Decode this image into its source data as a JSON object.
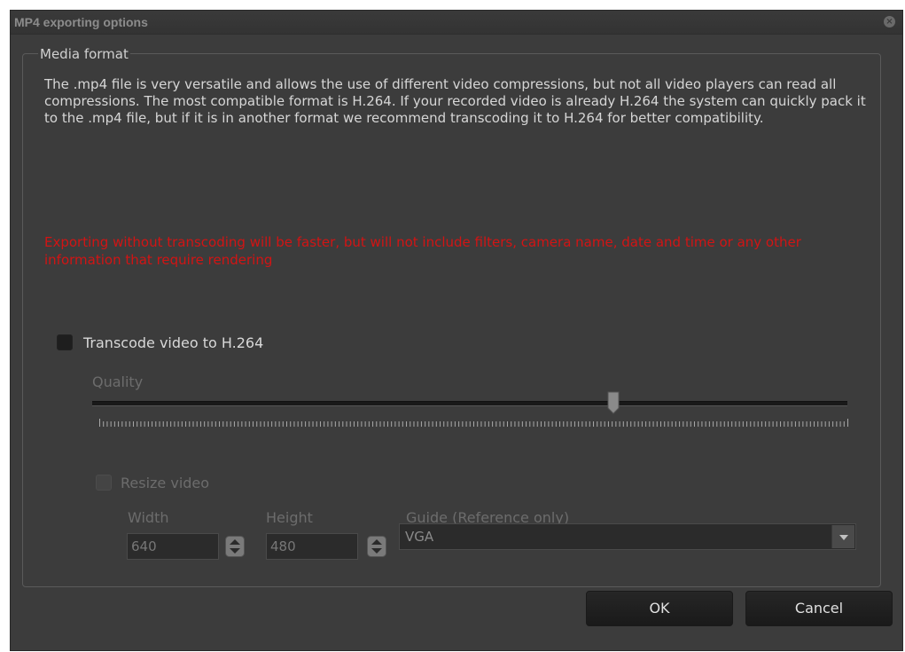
{
  "window": {
    "title": "MP4 exporting options",
    "close_icon": "close-icon"
  },
  "media_format": {
    "group_title": "Media format",
    "description": "The .mp4 file is very versatile and allows the use of different video compressions, but not all video players can read all compressions. The most compatible format is H.264. If your recorded video is already H.264 the system can quickly pack it to the .mp4 file, but if it is in another format we recommend transcoding it to H.264 for better compatibility.",
    "warning": "Exporting without transcoding will be faster, but will not include filters, camera name, date and time or any other information that require rendering",
    "warning_color": "#d21414",
    "transcode": {
      "label": "Transcode video to H.264",
      "checked": false
    },
    "quality": {
      "label": "Quality",
      "value_fraction": 0.69
    },
    "resize": {
      "label": "Resize video",
      "checked": false,
      "width_label": "Width",
      "width_value": "640",
      "height_label": "Height",
      "height_value": "480",
      "guide_label": "Guide (Reference only)",
      "guide_value": "VGA"
    }
  },
  "buttons": {
    "ok": "OK",
    "cancel": "Cancel"
  }
}
